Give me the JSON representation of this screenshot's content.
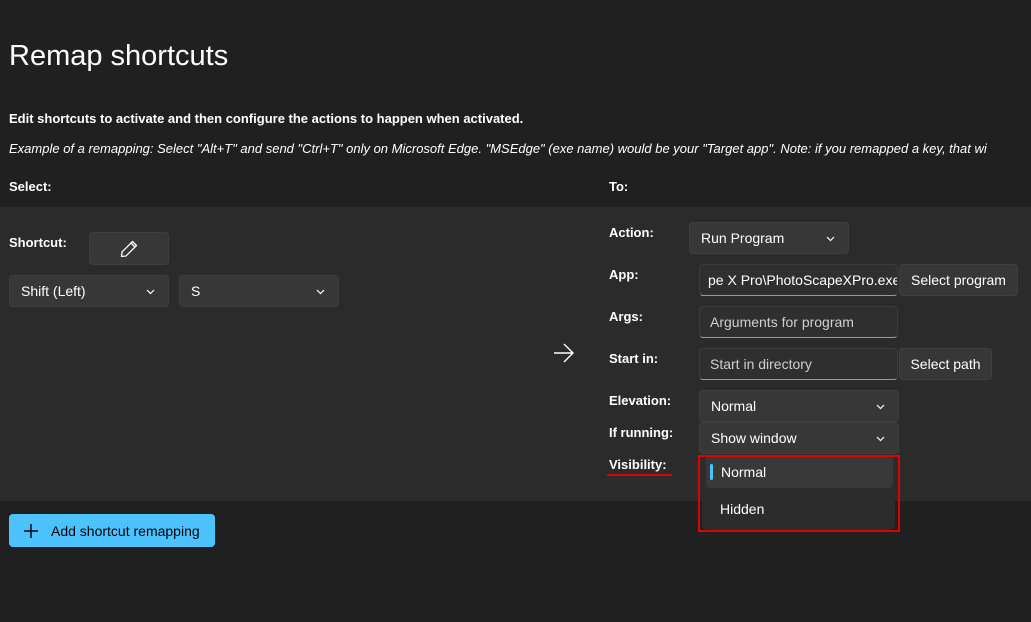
{
  "page": {
    "title": "Remap shortcuts",
    "description": "Edit shortcuts to activate and then configure the actions to happen when activated.",
    "example": "Example of a remapping: Select \"Alt+T\" and send \"Ctrl+T\" only on Microsoft Edge. \"MSEdge\" (exe name) would be your \"Target app\". Note: if you remapped a key, that wi"
  },
  "headers": {
    "select": "Select:",
    "to": "To:"
  },
  "left": {
    "shortcut_label": "Shortcut:",
    "modifier_value": "Shift (Left)",
    "key_value": "S"
  },
  "right": {
    "action_label": "Action:",
    "action_value": "Run Program",
    "app_label": "App:",
    "app_value": "pe X Pro\\PhotoScapeXPro.exe",
    "select_program_label": "Select program",
    "args_label": "Args:",
    "args_placeholder": "Arguments for program",
    "start_in_label": "Start in:",
    "start_in_placeholder": "Start in directory",
    "select_path_label": "Select path",
    "elevation_label": "Elevation:",
    "elevation_value": "Normal",
    "if_running_label": "If running:",
    "if_running_value": "Show window",
    "visibility_label": "Visibility:",
    "visibility_options": [
      "Normal",
      "Hidden"
    ]
  },
  "footer": {
    "add_label": "Add shortcut remapping"
  },
  "colors": {
    "accent": "#4cc2ff",
    "highlight": "#e00000",
    "background": "#202020",
    "panel": "#2b2b2b"
  }
}
